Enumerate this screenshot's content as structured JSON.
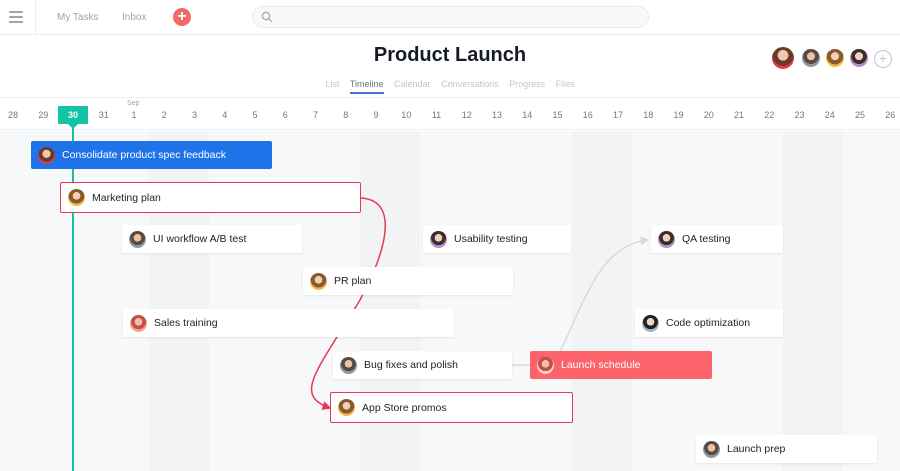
{
  "nav": {
    "my_tasks": "My Tasks",
    "inbox": "Inbox",
    "add": "+"
  },
  "header": {
    "title": "Product Launch",
    "tabs": [
      "List",
      "Timeline",
      "Calendar",
      "Conversations",
      "Progress",
      "Files"
    ],
    "active_tab": "Timeline",
    "add_member": "+"
  },
  "timeline": {
    "month_label": "Sep",
    "today": "30",
    "days": [
      "28",
      "29",
      "30",
      "31",
      "1",
      "2",
      "3",
      "4",
      "5",
      "6",
      "7",
      "8",
      "9",
      "10",
      "11",
      "12",
      "13",
      "14",
      "15",
      "16",
      "17",
      "18",
      "19",
      "20",
      "21",
      "22",
      "23",
      "24",
      "25",
      "26"
    ]
  },
  "tasks": [
    {
      "name": "Consolidate product spec feedback",
      "style": "blue"
    },
    {
      "name": "Marketing plan",
      "style": "outlined"
    },
    {
      "name": "UI workflow A/B test",
      "style": "default"
    },
    {
      "name": "Usability testing",
      "style": "default"
    },
    {
      "name": "QA testing",
      "style": "default"
    },
    {
      "name": "PR plan",
      "style": "default"
    },
    {
      "name": "Sales training",
      "style": "default"
    },
    {
      "name": "Code optimization",
      "style": "default"
    },
    {
      "name": "Bug fixes and polish",
      "style": "default"
    },
    {
      "name": "Launch schedule",
      "style": "coral"
    },
    {
      "name": "App Store promos",
      "style": "outlined"
    },
    {
      "name": "Launch prep",
      "style": "default"
    }
  ],
  "colors": {
    "today": "#14c3a2",
    "blue_task": "#1f73e8",
    "coral_task": "#fc636b",
    "dependency_red": "#e8384f",
    "dependency_gray": "#d5dadf",
    "tab_underline": "#4573d2"
  },
  "icons": {
    "menu": "hamburger-icon",
    "search": "search-icon",
    "add": "plus-icon"
  }
}
